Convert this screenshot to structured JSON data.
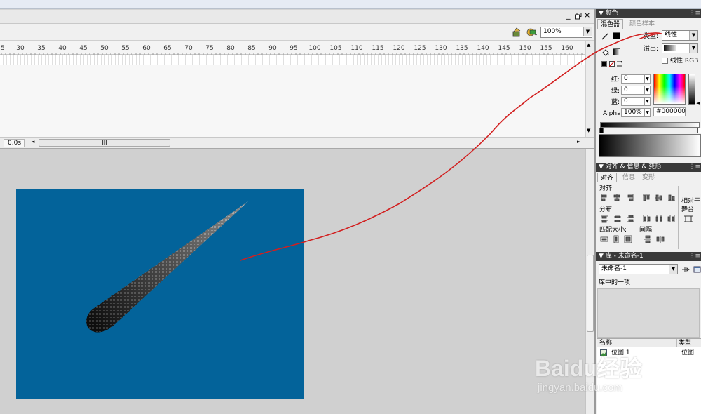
{
  "zoom": {
    "value": "100%"
  },
  "ruler": {
    "numbers": [
      "5",
      "30",
      "35",
      "40",
      "45",
      "50",
      "55",
      "60",
      "65",
      "70",
      "75",
      "80",
      "85",
      "90",
      "95",
      "100",
      "105",
      "110",
      "115",
      "120",
      "125",
      "130",
      "135",
      "140",
      "145",
      "150",
      "155",
      "160"
    ]
  },
  "timeline": {
    "elapsed": "0.0s",
    "scroll_grip": "III"
  },
  "color_panel": {
    "title": "颜色",
    "tab_mixer": "混色器",
    "tab_swatches": "颜色样本",
    "type_label": "类型:",
    "type_value": "线性",
    "overflow_label": "溢出:",
    "linear_rgb_label": "线性 RGB",
    "red_label": "红:",
    "red_value": "0",
    "green_label": "绿:",
    "green_value": "0",
    "blue_label": "蓝:",
    "blue_value": "0",
    "alpha_label": "Alpha:",
    "alpha_value": "100%",
    "hex_value": "#000000"
  },
  "align_panel": {
    "title": "对齐 & 信息 & 变形",
    "tab_align": "对齐",
    "tab_info": "信息",
    "tab_transform": "变形",
    "align_label": "对齐:",
    "distribute_label": "分布:",
    "match_size_label": "匹配大小:",
    "spacing_label": "间隔:",
    "relative_label": "相对于",
    "stage_label": "舞台:"
  },
  "library_panel": {
    "title": "库 - 未命名-1",
    "doc_select": "未命名-1",
    "item_count": "库中的一项",
    "col_name": "名称",
    "col_type": "类型",
    "items": [
      {
        "name": "位图 1",
        "type": "位图"
      }
    ]
  },
  "watermark": {
    "brand": "Baidu经验",
    "url": "jingyan.baidu.com"
  },
  "colors": {
    "stage_bg": "#03639a",
    "annotation": "#d21f1f",
    "panel_header": "#3a3a3a"
  }
}
